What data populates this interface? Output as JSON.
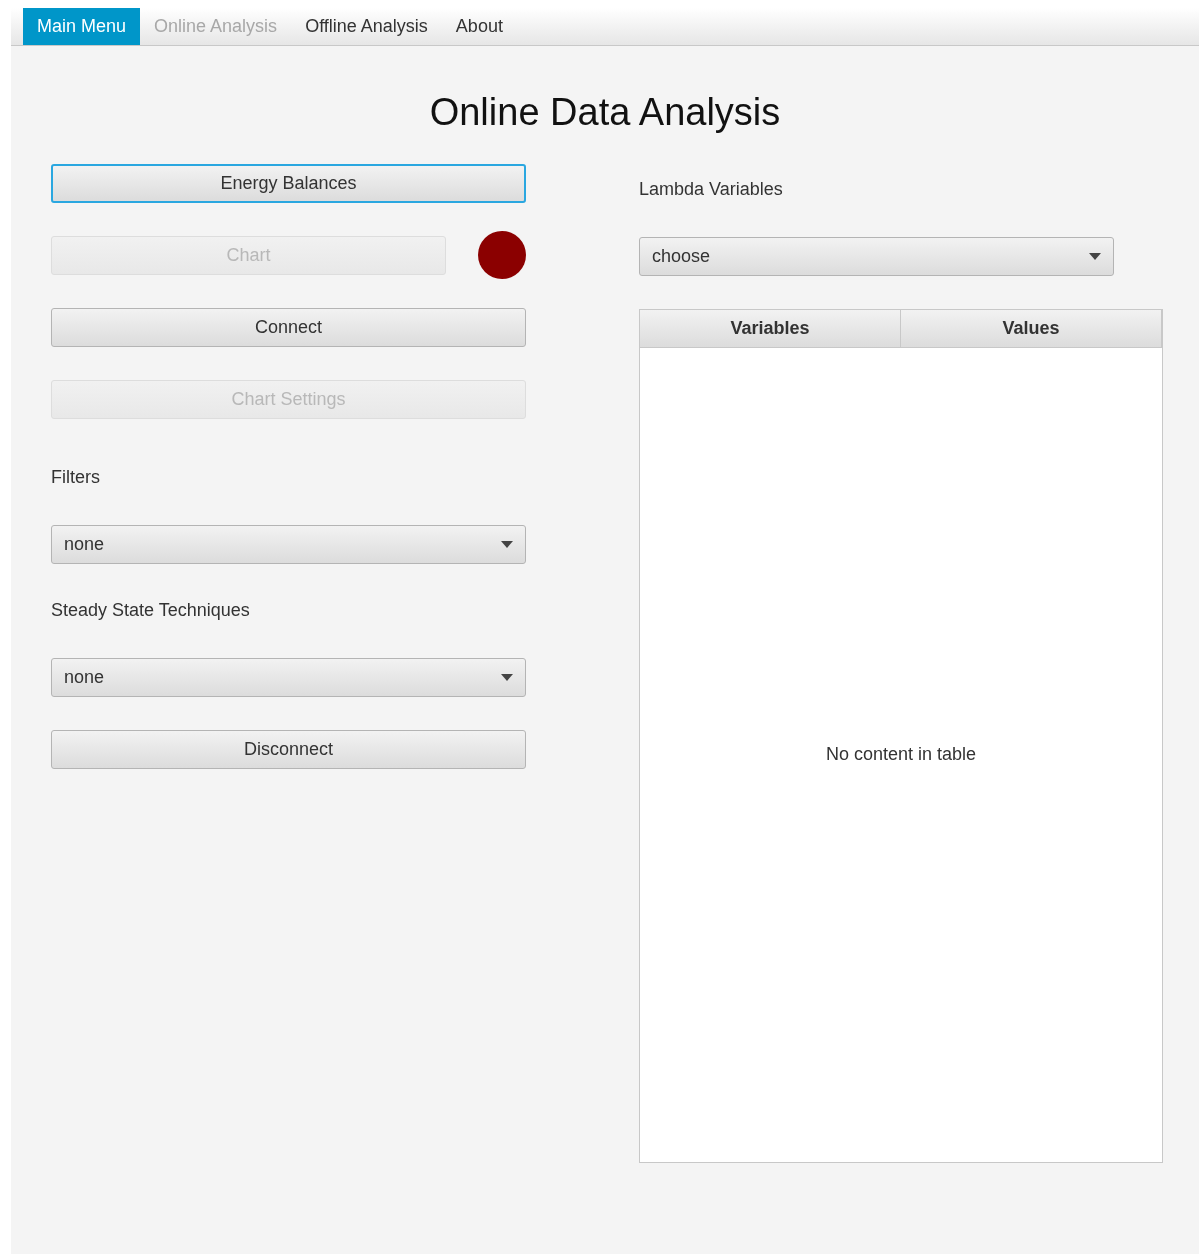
{
  "menu": [
    {
      "label": "Main Menu",
      "selected": true,
      "disabled": false
    },
    {
      "label": "Online Analysis",
      "selected": false,
      "disabled": true
    },
    {
      "label": "Offline Analysis",
      "selected": false,
      "disabled": false
    },
    {
      "label": "About",
      "selected": false,
      "disabled": false
    }
  ],
  "title": "Online Data Analysis",
  "left_controls": [
    {
      "kind": "button",
      "label": "Energy Balances",
      "focused": true,
      "disabled": false
    },
    {
      "kind": "button",
      "label": "Chart",
      "focused": false,
      "disabled": true,
      "indicator": {
        "color": "#8b0000"
      }
    },
    {
      "kind": "button",
      "label": "Connect",
      "focused": false,
      "disabled": false
    },
    {
      "kind": "button",
      "label": "Chart Settings",
      "focused": false,
      "disabled": true
    },
    {
      "kind": "label",
      "label": "Filters"
    },
    {
      "kind": "select",
      "value": "none"
    },
    {
      "kind": "label",
      "label": "Steady State Techniques"
    },
    {
      "kind": "select",
      "value": "none"
    },
    {
      "kind": "button",
      "label": "Disconnect",
      "focused": false,
      "disabled": false
    }
  ],
  "right_controls": [
    {
      "kind": "label",
      "label": "Lambda Variables"
    },
    {
      "kind": "select",
      "value": "choose"
    }
  ],
  "table": {
    "columns": [
      "Variables",
      "Values"
    ],
    "empty_message": "No content in table"
  }
}
